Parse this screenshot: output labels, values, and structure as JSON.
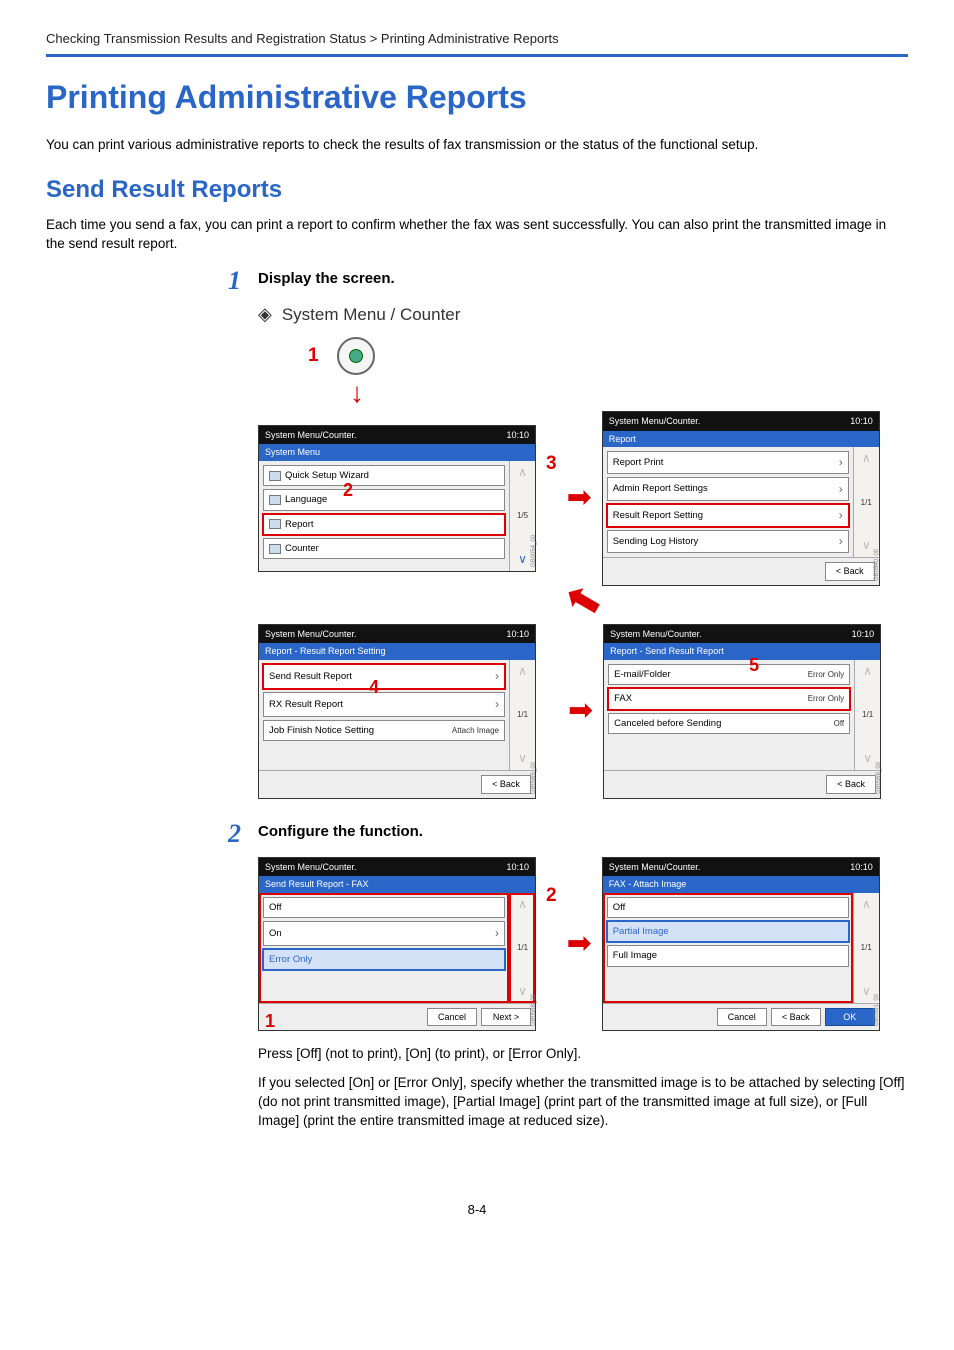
{
  "breadcrumb": "Checking Transmission Results and Registration Status > Printing Administrative Reports",
  "h1": "Printing Administrative Reports",
  "intro": "You can print various administrative reports to check the results of fax transmission or the status of the functional setup.",
  "h2": "Send Result Reports",
  "section_intro": "Each time you send a fax, you can print a report to confirm whether the fax was sent successfully. You can also print the transmitted image in the send result report.",
  "step1": {
    "num": "1",
    "title": "Display the screen.",
    "sysmenu": "System Menu / Counter",
    "press_label": "1"
  },
  "nav_labels": {
    "n2": "2",
    "n3": "3",
    "n4": "4",
    "n5": "5"
  },
  "panels": {
    "p1": {
      "title": "System Menu/Counter.",
      "time": "10:10",
      "sub": "System Menu",
      "items": [
        "Quick Setup Wizard",
        "Language",
        "Report",
        "Counter"
      ],
      "page": "1/5",
      "back": "",
      "gb": "GB0054_00"
    },
    "p2": {
      "title": "System Menu/Counter.",
      "time": "10:10",
      "sub": "Report",
      "items": [
        "Report Print",
        "Admin Report Settings",
        "Result Report Setting",
        "Sending Log History"
      ],
      "page": "1/1",
      "back": "< Back",
      "gb": "GB0540_00"
    },
    "p3": {
      "title": "System Menu/Counter.",
      "time": "10:10",
      "sub": "Report - Result Report Setting",
      "items": [
        {
          "label": "Send Result Report",
          "val": ""
        },
        {
          "label": "RX Result Report",
          "val": ""
        },
        {
          "label": "Job Finish Notice Setting",
          "val": "Attach Image"
        }
      ],
      "page": "1/1",
      "back": "< Back",
      "gb": "GB0565_00"
    },
    "p4": {
      "title": "System Menu/Counter.",
      "time": "10:10",
      "sub": "Report - Send Result Report",
      "items": [
        {
          "label": "E-mail/Folder",
          "val": "Error Only"
        },
        {
          "label": "FAX",
          "val": "Error Only"
        },
        {
          "label": "Canceled before Sending",
          "val": "Off"
        }
      ],
      "page": "1/1",
      "back": "< Back",
      "gb": "GB0568_00"
    }
  },
  "step2": {
    "num": "2",
    "title": "Configure the function.",
    "nav_labels": {
      "n1": "1",
      "n2": "2"
    },
    "p5": {
      "title": "System Menu/Counter.",
      "time": "10:10",
      "sub": "Send Result Report - FAX",
      "items": [
        "Off",
        "On",
        "Error Only"
      ],
      "page": "1/1",
      "cancel": "Cancel",
      "next": "Next >",
      "gb": "GB0588_00"
    },
    "p6": {
      "title": "System Menu/Counter.",
      "time": "10:10",
      "sub": "FAX - Attach Image",
      "items": [
        "Off",
        "Partial Image",
        "Full Image"
      ],
      "page": "1/1",
      "cancel": "Cancel",
      "back": "< Back",
      "ok": "OK",
      "gb": "GB0591_00"
    },
    "press_text": "Press [Off] (not to print), [On] (to print), or [Error Only].",
    "detail_text": "If you selected [On] or [Error Only], specify whether the transmitted image is to be attached by selecting [Off] (do not print transmitted image), [Partial Image] (print part of the transmitted image at full size), or [Full Image] (print the entire transmitted image at reduced size)."
  },
  "page_number": "8-4"
}
